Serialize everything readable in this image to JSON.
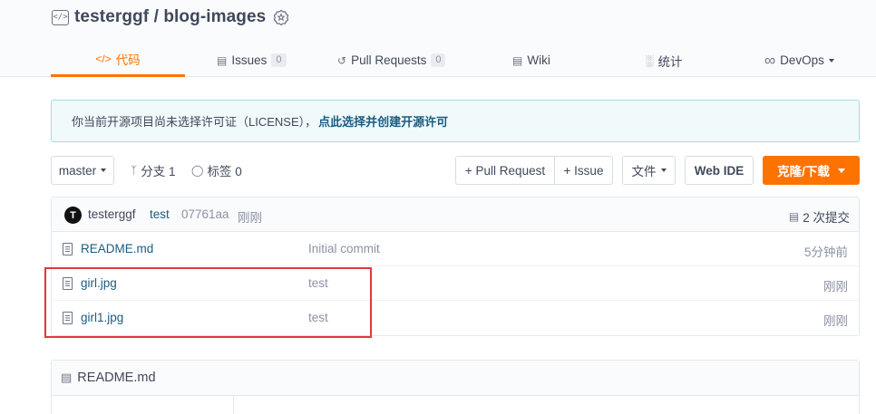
{
  "repo": {
    "owner_slash_name": "testerggf / blog-images"
  },
  "tabs": [
    {
      "label": "代码",
      "icon": "code-icon"
    },
    {
      "label": "Issues",
      "count": "0",
      "icon": "issues-icon"
    },
    {
      "label": "Pull Requests",
      "count": "0",
      "icon": "pull-request-icon"
    },
    {
      "label": "Wiki",
      "icon": "wiki-icon"
    },
    {
      "label": "统计",
      "icon": "chart-icon"
    },
    {
      "label": "DevOps",
      "icon": "infinity-icon"
    }
  ],
  "notice": {
    "text": "你当前开源项目尚未选择许可证（LICENSE），",
    "link": "点此选择并创建开源许可"
  },
  "toolbar": {
    "branch": "master",
    "branches": "分支 1",
    "tags": "标签 0",
    "new_pr": "+ Pull Request",
    "new_issue": "+ Issue",
    "file_menu": "文件",
    "web_ide": "Web IDE",
    "clone": "克隆/下载"
  },
  "commit": {
    "avatar_letter": "T",
    "author": "testerggf",
    "message": "test",
    "sha": "07761aa",
    "time": "刚刚",
    "count": "2 次提交"
  },
  "files": [
    {
      "name": "README.md",
      "message": "Initial commit",
      "time": "5分钟前"
    },
    {
      "name": "girl.jpg",
      "message": "test",
      "time": "刚刚"
    },
    {
      "name": "girl1.jpg",
      "message": "test",
      "time": "刚刚"
    }
  ],
  "readme": {
    "title": "README.md"
  },
  "colors": {
    "accent": "#fe7300",
    "link": "#1c5b80",
    "highlight": "#e0383e"
  }
}
